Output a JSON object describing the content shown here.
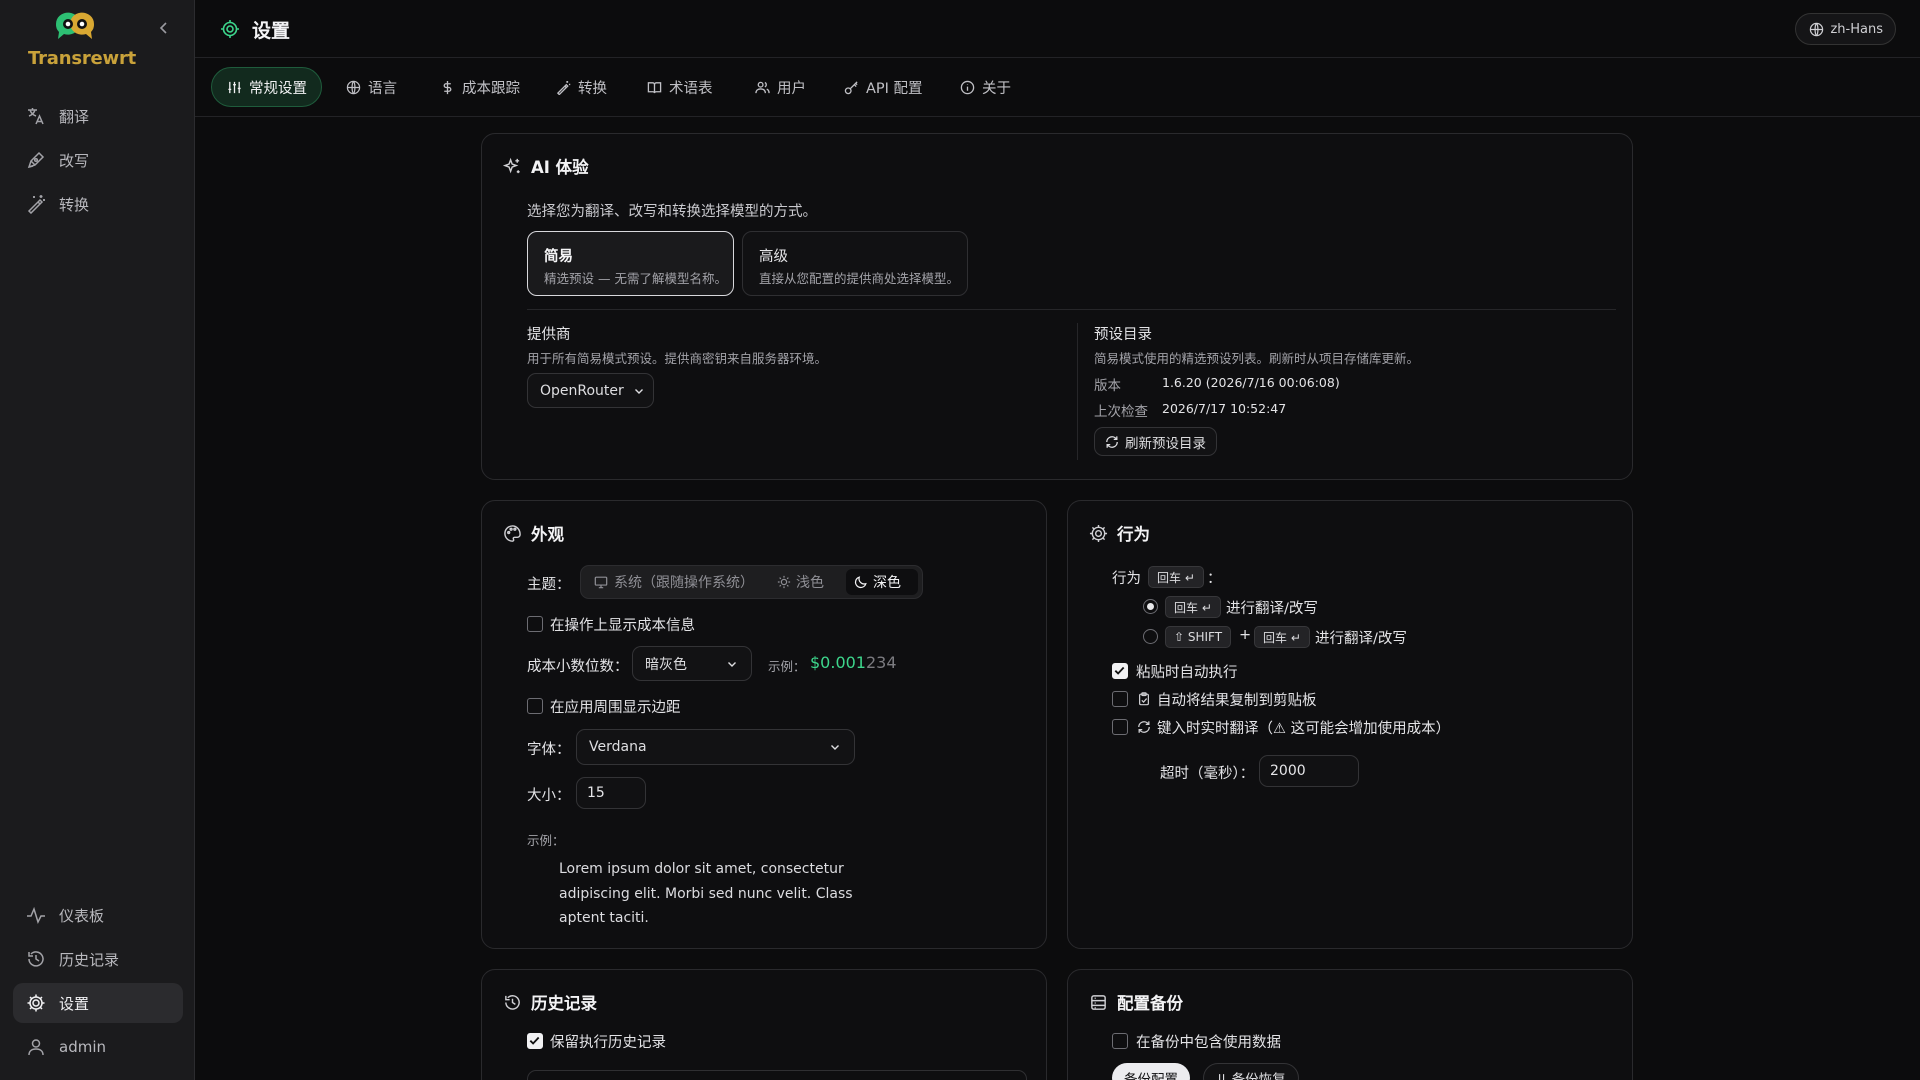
{
  "app": {
    "name": "Transrewrt"
  },
  "sidebar": {
    "items": [
      {
        "label": "翻译",
        "icon": "translate-icon"
      },
      {
        "label": "改写",
        "icon": "rewrite-icon"
      },
      {
        "label": "转换",
        "icon": "wand-icon"
      }
    ],
    "bottom_items": [
      {
        "label": "仪表板",
        "icon": "activity-icon"
      },
      {
        "label": "历史记录",
        "icon": "history-icon"
      },
      {
        "label": "设置",
        "icon": "gear-icon"
      },
      {
        "label": "admin",
        "icon": "user-icon"
      }
    ]
  },
  "header": {
    "title": "设置",
    "language": "zh-Hans"
  },
  "tabs": [
    {
      "label": "常规设置",
      "active": true
    },
    {
      "label": "语言"
    },
    {
      "label": "成本跟踪"
    },
    {
      "label": "转换"
    },
    {
      "label": "术语表"
    },
    {
      "label": "用户"
    },
    {
      "label": "API 配置"
    },
    {
      "label": "关于"
    }
  ],
  "ai": {
    "title": "AI 体验",
    "description": "选择您为翻译、改写和转换选择模型的方式。",
    "modes": [
      {
        "label": "简易",
        "desc": "精选预设 — 无需了解模型名称。",
        "selected": true
      },
      {
        "label": "高级",
        "desc": "直接从您配置的提供商处选择模型。"
      }
    ],
    "provider": {
      "title": "提供商",
      "desc": "用于所有简易模式预设。提供商密钥来自服务器环境。",
      "value": "OpenRouter"
    },
    "catalog": {
      "title": "预设目录",
      "desc": "简易模式使用的精选预设列表。刷新时从项目存储库更新。",
      "version_label": "版本",
      "version_value": "1.6.20 (2026/7/16 00:06:08)",
      "checked_label": "上次检查",
      "checked_value": "2026/7/17 10:52:47",
      "refresh_label": "刷新预设目录"
    }
  },
  "appearance": {
    "title": "外观",
    "theme_label": "主题：",
    "theme_options": [
      "系统（跟随操作系统）",
      "浅色",
      "深色"
    ],
    "theme_selected": "深色",
    "show_cost_label": "在操作上显示成本信息",
    "show_cost": false,
    "decimals_label": "成本小数位数：",
    "decimals_value": "暗灰色",
    "example_label": "示例：",
    "example_bright": "$0.001",
    "example_dim": "234",
    "margin_label": "在应用周围显示边距",
    "margin": false,
    "font_label": "字体：",
    "font_value": "Verdana",
    "size_label": "大小：",
    "size_value": "15",
    "sample_label": "示例：",
    "sample_lines": [
      "Lorem ipsum dolor sit amet, consectetur",
      "adipiscing elit. Morbi sed nunc velit. Class",
      "aptent taciti."
    ],
    "accent_color": "#3dd68c"
  },
  "behavior": {
    "title": "行为",
    "behavior_label": "行为",
    "behavior_key": "回车 ↵",
    "colon": "：",
    "option1_key": "回车 ↵",
    "option1_text": "进行翻译/改写",
    "option2_key1": "⇧ SHIFT",
    "plus": "+",
    "option2_key2": "回车 ↵",
    "option2_text": "进行翻译/改写",
    "auto_paste": "粘贴时自动执行",
    "auto_copy": "自动将结果复制到剪贴板",
    "live_translate": "键入时实时翻译（⚠ 这可能会增加使用成本）",
    "timeout_label": "超时（毫秒）：",
    "timeout_value": "2000"
  },
  "history": {
    "title": "历史记录",
    "keep_label": "保留执行历史记录",
    "keep": true
  },
  "backup": {
    "title": "配置备份",
    "include_usage": "在备份中包含使用数据",
    "backup_button": "备份配置",
    "restore_button": "⇊ 备份恢复"
  }
}
